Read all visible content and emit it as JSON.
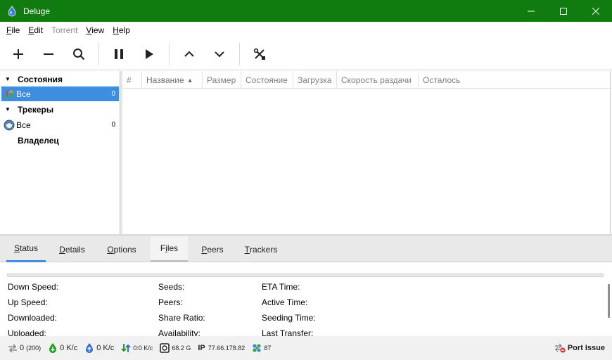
{
  "window": {
    "title": "Deluge",
    "minimize_icon": "minimize-icon",
    "maximize_icon": "maximize-icon",
    "close_icon": "close-icon"
  },
  "menu": [
    {
      "label_u": "F",
      "label_rest": "ile",
      "enabled": true
    },
    {
      "label_u": "E",
      "label_rest": "dit",
      "enabled": true
    },
    {
      "label_u": "",
      "label_rest": "Torrent",
      "enabled": false
    },
    {
      "label_u": "V",
      "label_rest": "iew",
      "enabled": true
    },
    {
      "label_u": "H",
      "label_rest": "elp",
      "enabled": true
    }
  ],
  "toolbar": {
    "buttons": [
      "add-icon",
      "remove-icon",
      "search-icon",
      "pause-icon",
      "play-icon",
      "move-up-icon",
      "move-down-icon",
      "preferences-icon"
    ]
  },
  "sidebar": {
    "states_header": "Состояния",
    "states_all_label": "Все",
    "states_all_count": "0",
    "trackers_header": "Трекеры",
    "trackers_all_label": "Все",
    "trackers_all_count": "0",
    "owner_header": "Владелец"
  },
  "columns": [
    "#",
    "Название",
    "Размер",
    "Состояние",
    "Загрузка",
    "Скорость раздачи",
    "Осталось"
  ],
  "tabs": {
    "status": {
      "u": "S",
      "rest": "tatus"
    },
    "details": {
      "u": "D",
      "rest": "etails"
    },
    "options": {
      "u": "O",
      "rest": "ptions"
    },
    "files": {
      "u": "i",
      "pre": "F",
      "rest": "les"
    },
    "peers": {
      "u": "P",
      "rest": "eers"
    },
    "trackers": {
      "u": "T",
      "rest": "rackers"
    }
  },
  "status_fields": {
    "col1": [
      "Down Speed:",
      "Up Speed:",
      "Downloaded:",
      "Uploaded:"
    ],
    "col2": [
      "Seeds:",
      "Peers:",
      "Share Ratio:",
      "Availability:"
    ],
    "col3": [
      "ETA Time:",
      "Active Time:",
      "Seeding Time:",
      "Last Transfer:"
    ]
  },
  "progress": 0,
  "statusbar": {
    "connections": "0",
    "connections_max": "(200)",
    "download_speed": "0 K/c",
    "upload_speed": "0 K/c",
    "protocol_traffic": "0:0 K/c",
    "free_space": "68.2 G",
    "ip_label": "IP",
    "ip_value": "77.66.178.82",
    "dht_nodes": "87",
    "port_issue": "Port Issue"
  },
  "colors": {
    "titlebar": "#107c10",
    "selection": "#3d8ee0",
    "green_arrow": "#1aa01a",
    "blue_arrow": "#2f6fd6"
  }
}
